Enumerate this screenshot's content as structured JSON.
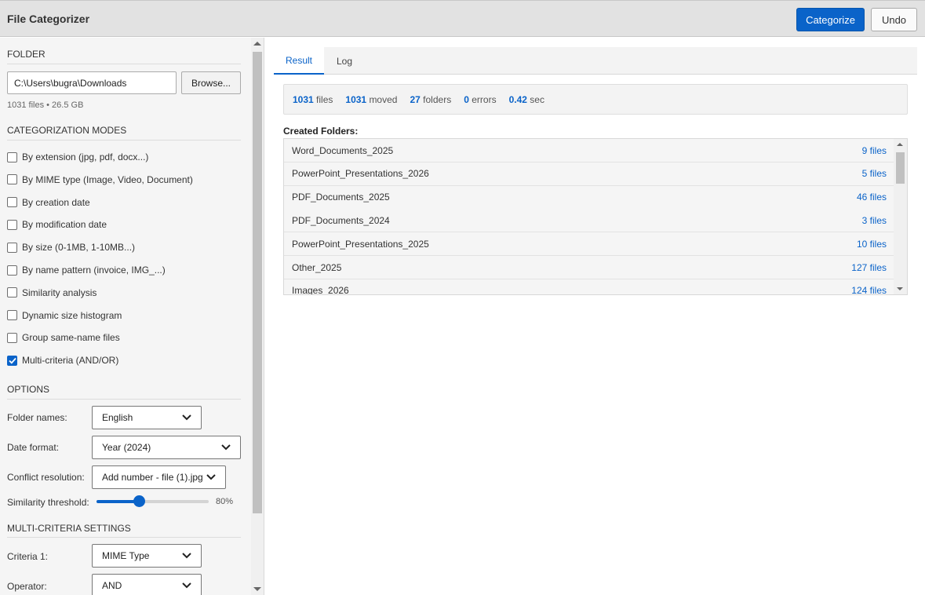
{
  "app": {
    "title": "File Categorizer"
  },
  "header": {
    "categorize_label": "Categorize",
    "undo_label": "Undo"
  },
  "folder": {
    "section_title": "FOLDER",
    "path": "C:\\Users\\bugra\\Downloads",
    "browse_label": "Browse...",
    "info": "1031 files • 26.5 GB"
  },
  "modes": {
    "section_title": "CATEGORIZATION MODES",
    "items": [
      {
        "label": "By extension (jpg, pdf, docx...)",
        "checked": false
      },
      {
        "label": "By MIME type (Image, Video, Document)",
        "checked": false
      },
      {
        "label": "By creation date",
        "checked": false
      },
      {
        "label": "By modification date",
        "checked": false
      },
      {
        "label": "By size (0-1MB, 1-10MB...)",
        "checked": false
      },
      {
        "label": "By name pattern (invoice, IMG_...)",
        "checked": false
      },
      {
        "label": "Similarity analysis",
        "checked": false
      },
      {
        "label": "Dynamic size histogram",
        "checked": false
      },
      {
        "label": "Group same-name files",
        "checked": false
      },
      {
        "label": "Multi-criteria (AND/OR)",
        "checked": true
      }
    ]
  },
  "options": {
    "section_title": "OPTIONS",
    "folder_names_label": "Folder names:",
    "folder_names_value": "English",
    "date_format_label": "Date format:",
    "date_format_value": "Year (2024)",
    "conflict_label": "Conflict resolution:",
    "conflict_value": "Add number - file (1).jpg",
    "similarity_label": "Similarity threshold:",
    "similarity_value_text": "80%",
    "similarity_value": 0.8
  },
  "multi": {
    "section_title": "MULTI-CRITERIA SETTINGS",
    "criteria1_label": "Criteria 1:",
    "criteria1_value": "MIME Type",
    "operator_label": "Operator:",
    "operator_value": "AND"
  },
  "tabs": [
    {
      "label": "Result",
      "active": true
    },
    {
      "label": "Log",
      "active": false
    }
  ],
  "stats": {
    "files_num": "1031",
    "files_label": "files",
    "moved_num": "1031",
    "moved_label": "moved",
    "folders_num": "27",
    "folders_label": "folders",
    "errors_num": "0",
    "errors_label": "errors",
    "time_num": "0.42",
    "time_label": "sec"
  },
  "created": {
    "title": "Created Folders:",
    "rows": [
      {
        "name": "Word_Documents_2025",
        "count": "9 files"
      },
      {
        "name": "PowerPoint_Presentations_2026",
        "count": "5 files"
      },
      {
        "name": "PDF_Documents_2025",
        "count": "46 files"
      },
      {
        "name": "PDF_Documents_2024",
        "count": "3 files"
      },
      {
        "name": "PowerPoint_Presentations_2025",
        "count": "10 files"
      },
      {
        "name": "Other_2025",
        "count": "127 files"
      },
      {
        "name": "Images_2026",
        "count": "124 files"
      }
    ]
  },
  "colors": {
    "accent": "#0a63c9"
  }
}
